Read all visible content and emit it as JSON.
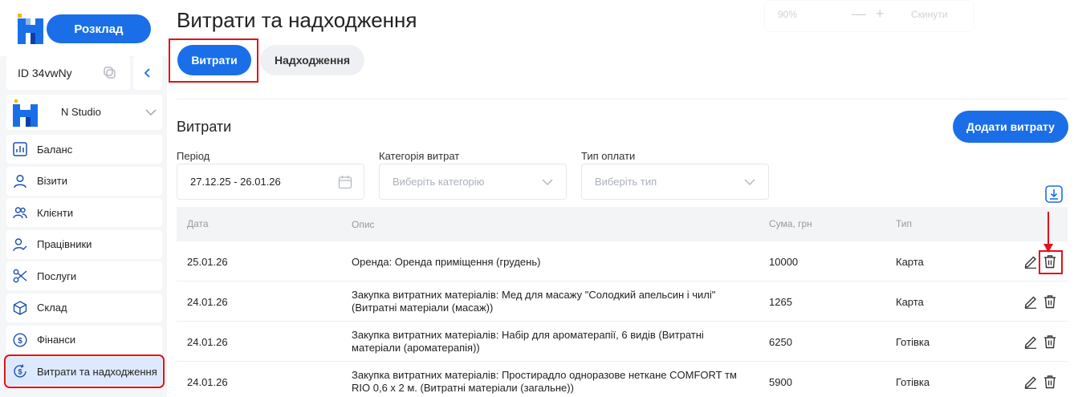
{
  "app": {
    "schedule_button": "Розклад",
    "id_label": "ID 34vwNy",
    "studio_name": "N Studio"
  },
  "colors": {
    "accent": "#1a6fe8",
    "highlight": "#e0121a",
    "active_nav_bg": "#dde9ff"
  },
  "sidebar": {
    "items": [
      {
        "label": "Баланс",
        "icon": "bar-chart-icon"
      },
      {
        "label": "Візити",
        "icon": "person-icon"
      },
      {
        "label": "Клієнти",
        "icon": "people-icon"
      },
      {
        "label": "Працівники",
        "icon": "person-check-icon"
      },
      {
        "label": "Послуги",
        "icon": "scissors-icon"
      },
      {
        "label": "Склад",
        "icon": "box-icon"
      },
      {
        "label": "Фінанси",
        "icon": "dollar-circle-icon"
      },
      {
        "label": "Витрати та надходження",
        "icon": "money-cycle-icon"
      }
    ]
  },
  "header": {
    "title": "Витрати та надходження",
    "zoom": {
      "value": "90%",
      "minus": "—",
      "plus": "+",
      "reset": "Скинути"
    }
  },
  "tabs": {
    "expenses": "Витрати",
    "income": "Надходження"
  },
  "section": {
    "title": "Витрати",
    "add_button": "Додати витрату"
  },
  "filters": {
    "period": {
      "label": "Період",
      "value": "27.12.25 - 26.01.26"
    },
    "category": {
      "label": "Категорія витрат",
      "placeholder": "Виберіть категорію"
    },
    "payment": {
      "label": "Тип оплати",
      "placeholder": "Виберіть тип"
    }
  },
  "table": {
    "columns": [
      "Дата",
      "Опис",
      "Сума, грн",
      "Тип"
    ],
    "rows": [
      {
        "date": "25.01.26",
        "desc": "Оренда: Оренда приміщення (грудень)",
        "sum": "10000",
        "type": "Карта"
      },
      {
        "date": "24.01.26",
        "desc": "Закупка витратних матеріалів: Мед для масажу \"Солодкий апельсин і чилі\" (Витратні матеріали (масаж))",
        "sum": "1265",
        "type": "Карта"
      },
      {
        "date": "24.01.26",
        "desc": "Закупка витратних матеріалів: Набір для ароматерапії, 6 видів (Витратні матеріали (ароматерапія))",
        "sum": "6250",
        "type": "Готівка"
      },
      {
        "date": "24.01.26",
        "desc": "Закупка витратних матеріалів: Простирадло одноразове неткане COMFORT тм RIO 0,6 х 2 м. (Витратні матеріали (загальне))",
        "sum": "5900",
        "type": "Готівка"
      }
    ]
  }
}
